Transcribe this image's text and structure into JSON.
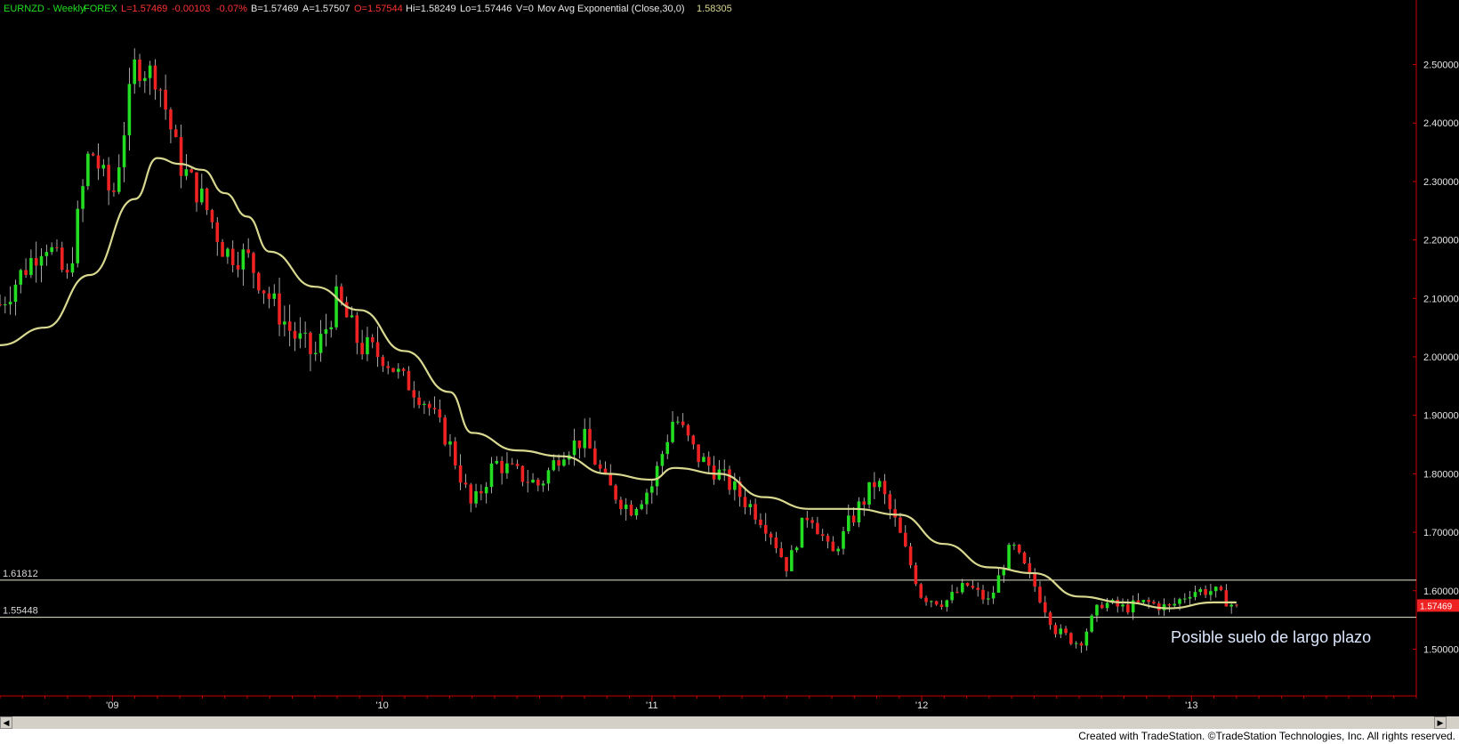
{
  "header": {
    "symbol": "EURNZD - Weekly",
    "market": "FOREX",
    "last": "L=1.57469",
    "change": "-0.00103",
    "change_pct": "-0.07%",
    "bid": "B=1.57469",
    "ask": "A=1.57507",
    "open": "O=1.57544",
    "high": "Hi=1.58249",
    "low": "Lo=1.57446",
    "volume": "V=0",
    "indicator": "Mov Avg Exponential (Close,30,0)",
    "indicator_value": "1.58305"
  },
  "colors": {
    "background": "#000000",
    "up_candle": "#22dd22",
    "down_candle": "#ee2222",
    "ema": "#d8d890",
    "level_line": "#e8e8c8",
    "header_green": "#22dd22",
    "header_red": "#ff3333",
    "header_white": "#e8e8e8",
    "axis": "#cc0000",
    "annotation": "#dde8ff",
    "price_marker": "#ee2222"
  },
  "levels": [
    {
      "label": "1.61812",
      "value": 1.61812
    },
    {
      "label": "1.55448",
      "value": 1.55448
    }
  ],
  "annotation": "Posible suelo de largo plazo",
  "current_price_marker": "1.57469",
  "footer": "Created with TradeStation. ©TradeStation Technologies, Inc. All rights reserved.",
  "chart_data": {
    "type": "candlestick",
    "timeframe": "weekly",
    "symbol": "EURNZD",
    "ylim": [
      1.42,
      2.58
    ],
    "y_ticks": [
      1.5,
      1.6,
      1.7,
      1.8,
      1.9,
      2.0,
      2.1,
      2.2,
      2.3,
      2.4,
      2.5
    ],
    "y_tick_labels": [
      "1.50000",
      "1.60000",
      "1.70000",
      "1.80000",
      "1.90000",
      "2.00000",
      "2.10000",
      "2.20000",
      "2.30000",
      "2.40000",
      "2.50000"
    ],
    "x_tick_labels": [
      "'09",
      "'10",
      "'11",
      "'12",
      "'13"
    ],
    "x_start": "2008-08",
    "x_end": "2013-11",
    "close_path": [
      [
        "2008-08",
        2.09
      ],
      [
        "2008-10",
        2.2
      ],
      [
        "2008-11",
        2.13
      ],
      [
        "2008-12",
        2.36
      ],
      [
        "2009-01",
        2.27
      ],
      [
        "2009-02",
        2.5
      ],
      [
        "2009-03",
        2.48
      ],
      [
        "2009-04",
        2.33
      ],
      [
        "2009-05",
        2.27
      ],
      [
        "2009-06",
        2.18
      ],
      [
        "2009-07",
        2.17
      ],
      [
        "2009-08",
        2.1
      ],
      [
        "2009-09",
        2.04
      ],
      [
        "2009-10",
        2.0
      ],
      [
        "2009-11",
        2.1
      ],
      [
        "2009-12",
        2.02
      ],
      [
        "2010-01",
        2.0
      ],
      [
        "2010-02",
        1.96
      ],
      [
        "2010-03",
        1.92
      ],
      [
        "2010-04",
        1.85
      ],
      [
        "2010-05",
        1.74
      ],
      [
        "2010-06",
        1.82
      ],
      [
        "2010-07",
        1.8
      ],
      [
        "2010-08",
        1.78
      ],
      [
        "2010-09",
        1.84
      ],
      [
        "2010-10",
        1.86
      ],
      [
        "2010-11",
        1.78
      ],
      [
        "2010-12",
        1.74
      ],
      [
        "2011-01",
        1.78
      ],
      [
        "2011-02",
        1.9
      ],
      [
        "2011-03",
        1.83
      ],
      [
        "2011-04",
        1.8
      ],
      [
        "2011-05",
        1.76
      ],
      [
        "2011-06",
        1.72
      ],
      [
        "2011-07",
        1.64
      ],
      [
        "2011-08",
        1.74
      ],
      [
        "2011-09",
        1.66
      ],
      [
        "2011-10",
        1.73
      ],
      [
        "2011-11",
        1.79
      ],
      [
        "2011-12",
        1.7
      ],
      [
        "2012-01",
        1.59
      ],
      [
        "2012-02",
        1.58
      ],
      [
        "2012-03",
        1.61
      ],
      [
        "2012-04",
        1.58
      ],
      [
        "2012-05",
        1.68
      ],
      [
        "2012-06",
        1.61
      ],
      [
        "2012-07",
        1.53
      ],
      [
        "2012-08",
        1.51
      ],
      [
        "2012-09",
        1.58
      ],
      [
        "2012-10",
        1.57
      ],
      [
        "2012-11",
        1.58
      ],
      [
        "2012-12",
        1.57
      ],
      [
        "2013-01",
        1.6
      ],
      [
        "2013-02",
        1.6
      ],
      [
        "2013-03",
        1.57
      ]
    ],
    "ema_path": [
      [
        "2008-08",
        2.02
      ],
      [
        "2008-10",
        2.05
      ],
      [
        "2008-12",
        2.14
      ],
      [
        "2009-02",
        2.27
      ],
      [
        "2009-03",
        2.34
      ],
      [
        "2009-04",
        2.33
      ],
      [
        "2009-05",
        2.32
      ],
      [
        "2009-06",
        2.28
      ],
      [
        "2009-07",
        2.24
      ],
      [
        "2009-08",
        2.18
      ],
      [
        "2009-10",
        2.12
      ],
      [
        "2009-12",
        2.08
      ],
      [
        "2010-02",
        2.01
      ],
      [
        "2010-04",
        1.94
      ],
      [
        "2010-05",
        1.87
      ],
      [
        "2010-07",
        1.84
      ],
      [
        "2010-09",
        1.83
      ],
      [
        "2010-11",
        1.8
      ],
      [
        "2011-01",
        1.79
      ],
      [
        "2011-02",
        1.81
      ],
      [
        "2011-04",
        1.8
      ],
      [
        "2011-06",
        1.76
      ],
      [
        "2011-08",
        1.74
      ],
      [
        "2011-10",
        1.74
      ],
      [
        "2011-12",
        1.73
      ],
      [
        "2012-02",
        1.68
      ],
      [
        "2012-04",
        1.64
      ],
      [
        "2012-06",
        1.63
      ],
      [
        "2012-08",
        1.59
      ],
      [
        "2012-10",
        1.58
      ],
      [
        "2012-12",
        1.57
      ],
      [
        "2013-02",
        1.58
      ],
      [
        "2013-03",
        1.58
      ]
    ]
  }
}
